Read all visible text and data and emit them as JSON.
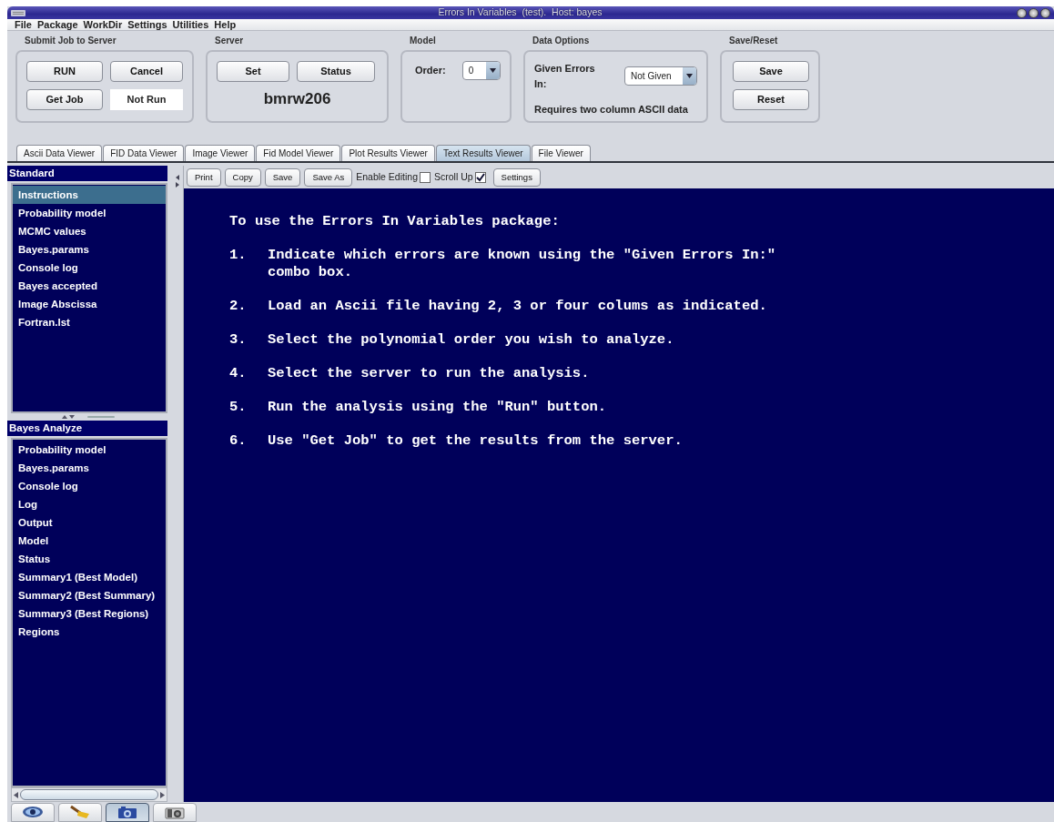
{
  "window": {
    "title": "Errors In Variables  (test).  Host: bayes"
  },
  "menu": [
    "File",
    "Package",
    "WorkDir",
    "Settings",
    "Utilities",
    "Help"
  ],
  "submit": {
    "title": "Submit Job to Server",
    "buttons": [
      "RUN",
      "Cancel",
      "Get Job"
    ],
    "status": "Not Run"
  },
  "server": {
    "title": "Server",
    "buttons": [
      "Set",
      "Status"
    ],
    "host": "bmrw206"
  },
  "model": {
    "title": "Model",
    "label": "Order:",
    "value": "0"
  },
  "data_options": {
    "title": "Data Options",
    "label": "Given Errors In:",
    "value": "Not Given",
    "note": "Requires two column ASCII data"
  },
  "save_reset": {
    "title": "Save/Reset",
    "buttons": [
      "Save",
      "Reset"
    ]
  },
  "tabs": [
    {
      "label": "Ascii Data Viewer",
      "selected": false
    },
    {
      "label": "FID Data Viewer",
      "selected": false
    },
    {
      "label": "Image Viewer",
      "selected": false
    },
    {
      "label": "Fid Model Viewer",
      "selected": false
    },
    {
      "label": "Plot Results Viewer",
      "selected": false
    },
    {
      "label": "Text Results Viewer",
      "selected": true
    },
    {
      "label": "File Viewer",
      "selected": false
    }
  ],
  "panels": [
    {
      "title": "Standard",
      "items": [
        {
          "label": "Instructions",
          "selected": true
        },
        {
          "label": "Probability model",
          "selected": false
        },
        {
          "label": "MCMC values",
          "selected": false
        },
        {
          "label": "Bayes.params",
          "selected": false
        },
        {
          "label": "Console log",
          "selected": false
        },
        {
          "label": "Bayes accepted",
          "selected": false
        },
        {
          "label": "Image Abscissa",
          "selected": false
        },
        {
          "label": "Fortran.lst",
          "selected": false
        }
      ]
    },
    {
      "title": "Bayes Analyze",
      "items": [
        {
          "label": "Probability model",
          "selected": false
        },
        {
          "label": "Bayes.params",
          "selected": false
        },
        {
          "label": "Console log",
          "selected": false
        },
        {
          "label": "Log",
          "selected": false
        },
        {
          "label": "Output",
          "selected": false
        },
        {
          "label": "Model",
          "selected": false
        },
        {
          "label": "Status",
          "selected": false
        },
        {
          "label": "Summary1 (Best Model)",
          "selected": false
        },
        {
          "label": "Summary2 (Best Summary)",
          "selected": false
        },
        {
          "label": "Summary3 (Best Regions)",
          "selected": false
        },
        {
          "label": "Regions",
          "selected": false
        }
      ]
    }
  ],
  "text_toolbar": {
    "buttons": [
      "Print",
      "Copy",
      "Save",
      "Save As"
    ],
    "checkboxes": [
      {
        "label": "Enable Editing",
        "checked": false
      },
      {
        "label": "Scroll Up",
        "checked": true
      }
    ],
    "settings": "Settings"
  },
  "text": {
    "intro": "To use the Errors In Variables package:",
    "steps": [
      {
        "number": "1.",
        "lines": [
          "Indicate which errors are known using the \"Given Errors In:\"",
          "combo box."
        ]
      },
      {
        "number": "2.",
        "lines": [
          "Load an Ascii file having 2, 3 or four colums as indicated."
        ]
      },
      {
        "number": "3.",
        "lines": [
          "Select the polynomial order you wish to analyze."
        ]
      },
      {
        "number": "4.",
        "lines": [
          "Select the server to run the analysis."
        ]
      },
      {
        "number": "5.",
        "lines": [
          "Run the analysis using the \"Run\" button."
        ]
      },
      {
        "number": "6.",
        "lines": [
          "Use \"Get Job\" to get the results from the server."
        ]
      }
    ]
  },
  "bottom_tools": [
    {
      "kind": "eye",
      "selected": false
    },
    {
      "kind": "broom",
      "selected": false
    },
    {
      "kind": "camera",
      "selected": true
    },
    {
      "kind": "camera_grey",
      "selected": false
    }
  ]
}
